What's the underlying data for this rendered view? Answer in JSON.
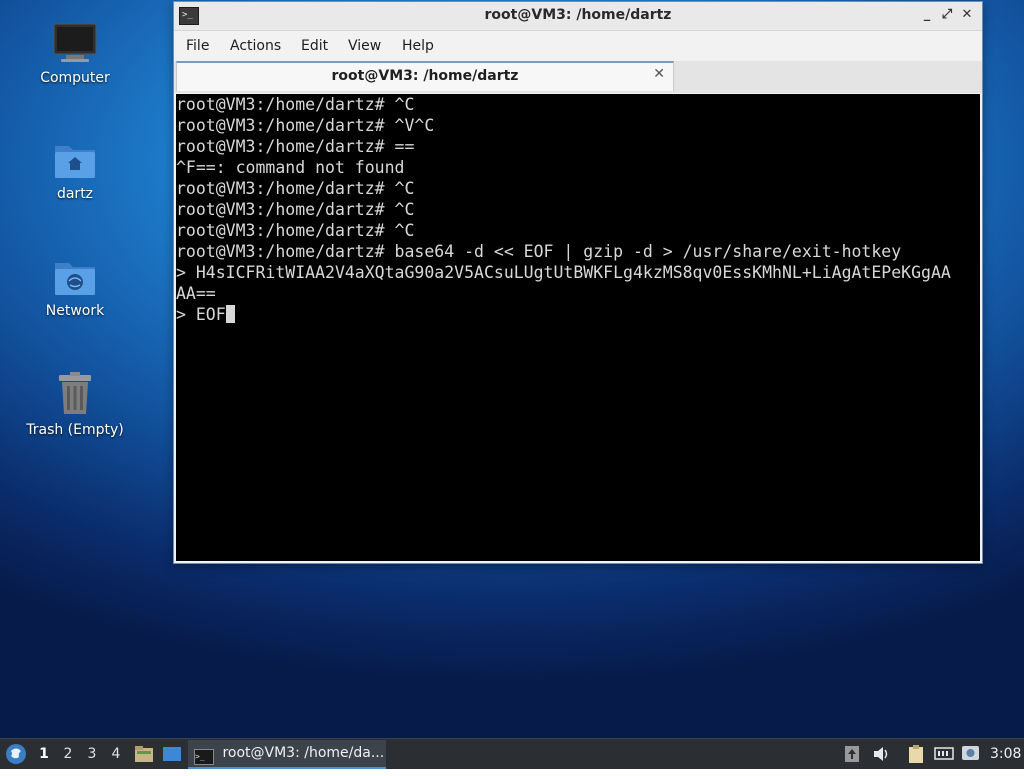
{
  "desktop": {
    "icons": [
      {
        "label": "Computer",
        "icon": "computer-icon"
      },
      {
        "label": "dartz",
        "icon": "home-folder-icon"
      },
      {
        "label": "Network",
        "icon": "network-folder-icon"
      },
      {
        "label": "Trash (Empty)",
        "icon": "trash-icon"
      }
    ]
  },
  "window": {
    "title": "root@VM3: /home/dartz",
    "controls": {
      "minimize": "_",
      "maximize": "⤢",
      "close": "✕"
    },
    "menu": [
      "File",
      "Actions",
      "Edit",
      "View",
      "Help"
    ],
    "tab": {
      "label": "root@VM3: /home/dartz",
      "close": "✕"
    }
  },
  "terminal": {
    "lines": [
      "root@VM3:/home/dartz# ^C",
      "root@VM3:/home/dartz# ^V^C",
      "root@VM3:/home/dartz# ==",
      "^F==: command not found",
      "root@VM3:/home/dartz# ^C",
      "root@VM3:/home/dartz# ^C",
      "root@VM3:/home/dartz# ^C",
      "root@VM3:/home/dartz# base64 -d << EOF | gzip -d > /usr/share/exit-hotkey",
      "> H4sICFRitWIAA2V4aXQtaG90a2V5ACsuLUgtUtBWKFLg4kzMS8qv0EssKMhNL+LiAgAtEPeKGgAA",
      "AA=="
    ],
    "prompt_line": "> EOF"
  },
  "taskbar": {
    "workspaces": [
      "1",
      "2",
      "3",
      "4"
    ],
    "active_workspace": "1",
    "task_label": "root@VM3: /home/da...",
    "clock": "3:08"
  },
  "colors": {
    "accent": "#4a90d9",
    "terminal_bg": "#000000",
    "terminal_fg": "#d8d8d8",
    "taskbar_bg": "#2b2f33"
  }
}
